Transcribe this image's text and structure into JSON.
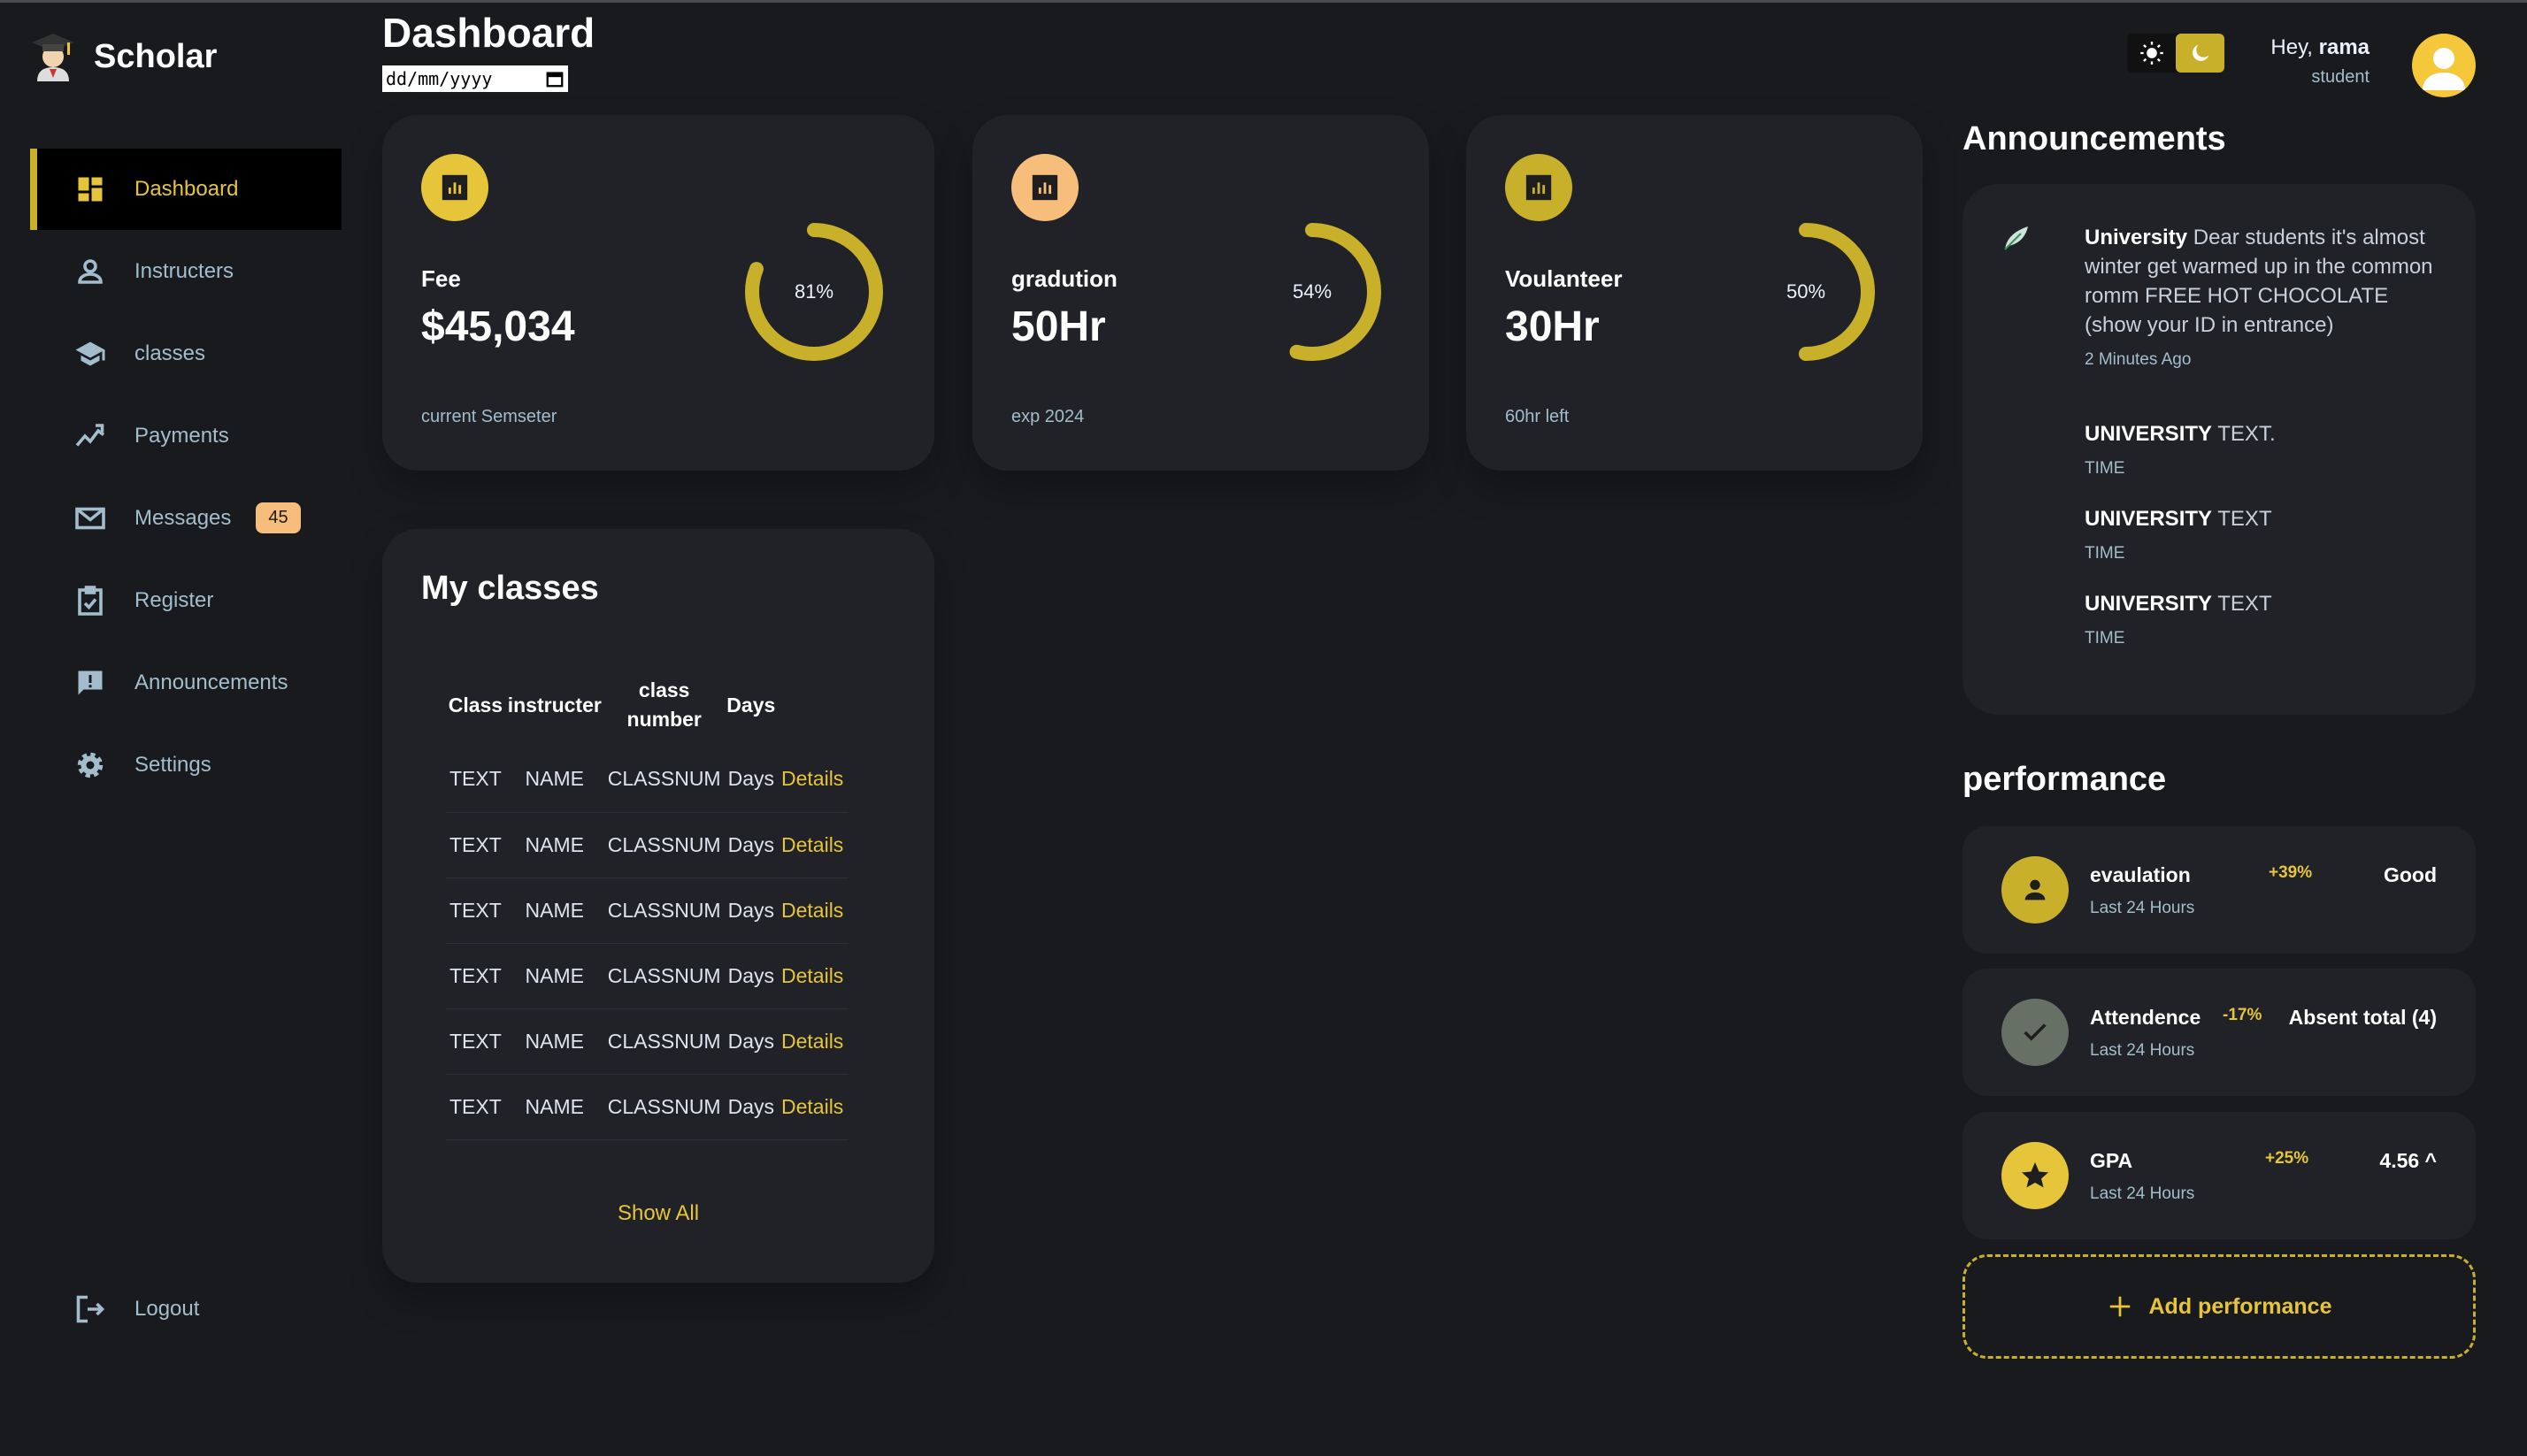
{
  "brand": {
    "name": "Scholar"
  },
  "nav": [
    {
      "label": "Dashboard",
      "icon": "dashboard-icon"
    },
    {
      "label": "Instructers",
      "icon": "person-icon"
    },
    {
      "label": "classes",
      "icon": "school-icon"
    },
    {
      "label": "Payments",
      "icon": "trending-icon"
    },
    {
      "label": "Messages",
      "icon": "mail-icon",
      "badge": "45"
    },
    {
      "label": "Register",
      "icon": "clipboard-icon"
    },
    {
      "label": "Announcements",
      "icon": "report-icon"
    },
    {
      "label": "Settings",
      "icon": "gear-icon"
    }
  ],
  "logout": {
    "label": "Logout"
  },
  "header": {
    "title": "Dashboard",
    "date_placeholder": "dd/mm/yyyy",
    "greeting": "Hey, ",
    "user": "rama",
    "role": "student"
  },
  "stats": [
    {
      "label": "Fee",
      "value": "$45,034",
      "sub": "current Semseter",
      "percent_label": "81%",
      "percent": 81,
      "icon_color": "#e6c53a"
    },
    {
      "label": "gradution",
      "value": "50Hr",
      "sub": "exp 2024",
      "percent_label": "54%",
      "percent": 54,
      "icon_color": "#f7be7b"
    },
    {
      "label": "Voulanteer",
      "value": "30Hr",
      "sub": "60hr left",
      "percent_label": "50%",
      "percent": 50,
      "icon_color": "#c9b02b"
    }
  ],
  "classes": {
    "title": "My classes",
    "headers": [
      "Class",
      "instructer",
      "class number",
      "Days"
    ],
    "rows": [
      [
        "TEXT",
        "NAME",
        "CLASSNUM",
        "Days",
        "Details"
      ],
      [
        "TEXT",
        "NAME",
        "CLASSNUM",
        "Days",
        "Details"
      ],
      [
        "TEXT",
        "NAME",
        "CLASSNUM",
        "Days",
        "Details"
      ],
      [
        "TEXT",
        "NAME",
        "CLASSNUM",
        "Days",
        "Details"
      ],
      [
        "TEXT",
        "NAME",
        "CLASSNUM",
        "Days",
        "Details"
      ],
      [
        "TEXT",
        "NAME",
        "CLASSNUM",
        "Days",
        "Details"
      ]
    ],
    "show_all": "Show All"
  },
  "announcements": {
    "title": "Announcements",
    "items": [
      {
        "source": "University",
        "text": " Dear students it's almost winter get warmed up in the common romm FREE HOT CHOCOLATE (show your ID in entrance)",
        "time": "2 Minutes Ago"
      },
      {
        "source": "UNIVERSITY",
        "text": " TEXT.",
        "time": "TIME"
      },
      {
        "source": "UNIVERSITY",
        "text": " TEXT",
        "time": "TIME"
      },
      {
        "source": "UNIVERSITY",
        "text": " TEXT",
        "time": "TIME"
      }
    ]
  },
  "performance": {
    "title": "performance",
    "items": [
      {
        "name": "evaulation",
        "sub": "Last 24 Hours",
        "change": "+39%",
        "value": "Good",
        "icon": "person-icon",
        "icon_color": "#c9b02b"
      },
      {
        "name": "Attendence",
        "sub": "Last 24 Hours",
        "change": "-17%",
        "value": "Absent total (4)",
        "icon": "check-icon",
        "icon_color": "#677065"
      },
      {
        "name": "GPA",
        "sub": "Last 24 Hours",
        "change": "+25%",
        "value": "4.56 ^",
        "icon": "star-icon",
        "icon_color": "#e6c53a"
      }
    ],
    "add_label": "Add performance"
  },
  "colors": {
    "accent": "#e6c53a",
    "background": "#181a1e",
    "card": "#202227"
  }
}
